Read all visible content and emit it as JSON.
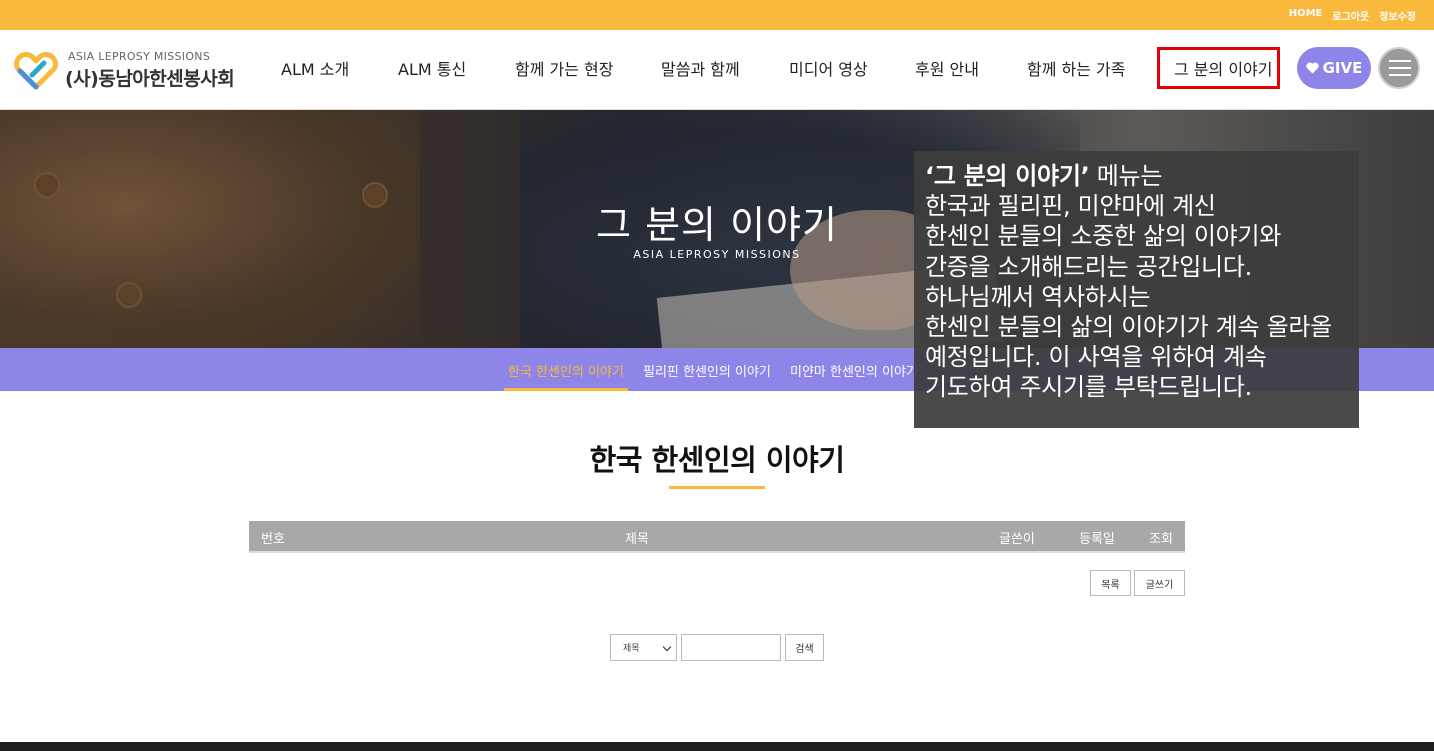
{
  "topbar": {
    "links": [
      "HOME",
      "로그아웃",
      "정보수정"
    ]
  },
  "logo": {
    "en": "ASIA LEPROSY MISSIONS",
    "ko": "(사)동남아한센봉사회"
  },
  "nav": {
    "items": [
      "ALM 소개",
      "ALM 통신",
      "함께 가는 현장",
      "말씀과 함께",
      "미디어 영상",
      "후원 안내",
      "함께 하는 가족",
      "그 분의 이야기"
    ],
    "give_label": "GIVE",
    "active_index": 7
  },
  "hero": {
    "title": "그 분의 이야기",
    "subtitle": "ASIA LEPROSY MISSIONS"
  },
  "subnav": {
    "items": [
      "한국 한센인의 이야기",
      "필리핀 한센인의 이야기",
      "미얀마 한센인의 이야기"
    ],
    "active_index": 0
  },
  "tooltip": {
    "bold": "‘그 분의 이야기’",
    "first_rest": " 메뉴는",
    "lines": [
      "한국과 필리핀, 미얀마에 계신",
      "한센인 분들의 소중한 삶의 이야기와",
      "간증을 소개해드리는 공간입니다.",
      "하나님께서 역사하시는",
      "한센인 분들의 삶의 이야기가 계속 올라올",
      "예정입니다. 이 사역을 위하여 계속",
      "기도하여 주시기를 부탁드립니다."
    ]
  },
  "main": {
    "title": "한국 한센인의 이야기"
  },
  "table": {
    "columns": [
      "번호",
      "제목",
      "글쓴이",
      "등록일",
      "조회"
    ]
  },
  "buttons": {
    "list": "목록",
    "write": "글쓰기"
  },
  "search": {
    "field_selected": "제목",
    "input_value": "",
    "button": "검색"
  },
  "colors": {
    "topbar": "#f8b93c",
    "accent_purple": "#8e85e8",
    "active_border": "#e40000"
  }
}
